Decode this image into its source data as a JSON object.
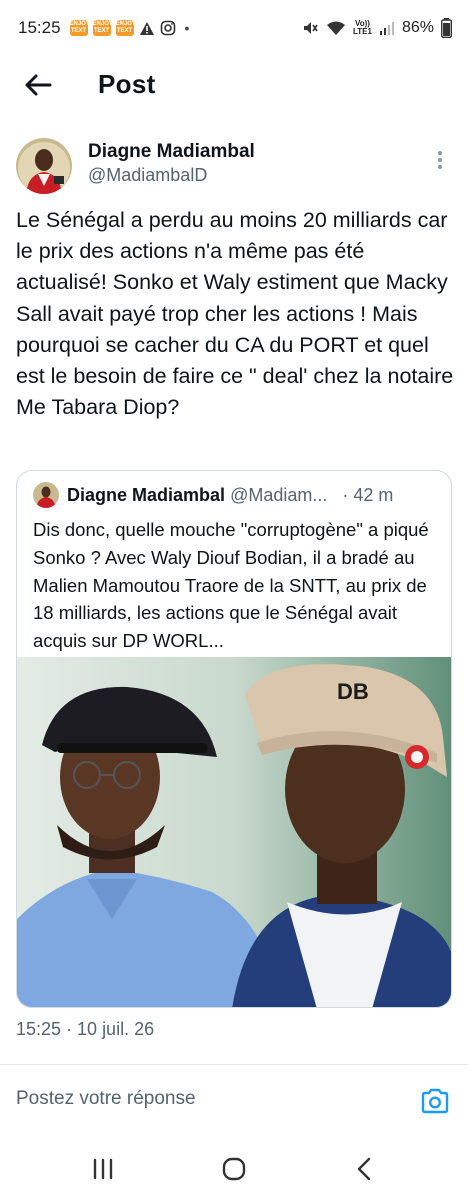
{
  "status_bar": {
    "time": "15:25",
    "notification_icons": [
      "sonatel-app-icon",
      "sonatel-app-icon",
      "sonatel-app-icon",
      "warning-icon",
      "instagram-icon"
    ],
    "notif_app_text": "ENJOY TEXT",
    "dot": "•",
    "volte_top": "Vo))",
    "volte_bottom": "LTE1",
    "battery": "86%"
  },
  "header": {
    "title": "Post"
  },
  "tweet": {
    "author_name": "Diagne Madiambal",
    "author_handle": "@MadiambalD",
    "text": "Le Sénégal a perdu au moins 20 milliards car le prix des actions n'a même pas été actualisé! Sonko et Waly estiment que Macky Sall avait payé trop cher les actions ! Mais pourquoi se cacher du CA du PORT et quel est le besoin de faire ce \" deal' chez la notaire Me Tabara Diop?",
    "timestamp": "15:25 · 10 juil. 26"
  },
  "quoted_tweet": {
    "author_name": "Diagne Madiambal",
    "author_handle": "@Madiam...",
    "time": "· 42 m",
    "text": "Dis donc, quelle mouche \"corruptogène\" a piqué Sonko ? Avec Waly Diouf Bodian, il a bradé au Malien Mamoutou Traore de la SNTT, au prix de 18 milliards, les actions que le Sénégal avait acquis sur DP WORL...",
    "image_cap_text": "DB"
  },
  "reply": {
    "placeholder": "Postez votre réponse"
  },
  "colors": {
    "text": "#0f1419",
    "secondary": "#536471",
    "accent": "#1d9bf0",
    "border": "#cfd9de"
  }
}
